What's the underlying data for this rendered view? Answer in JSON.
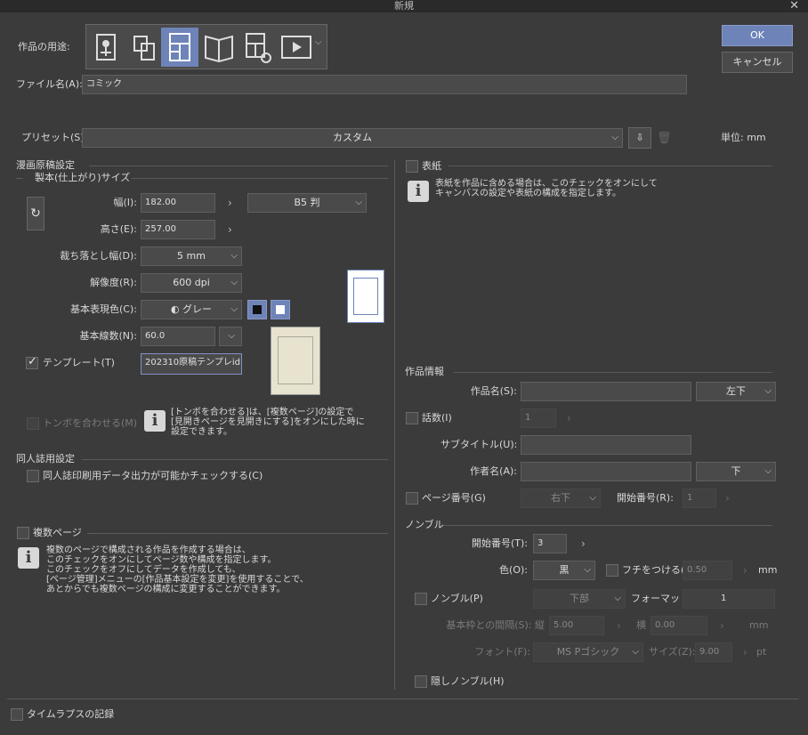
{
  "window": {
    "title": "新規"
  },
  "usage": {
    "label": "作品の用途:"
  },
  "buttons": {
    "ok": "OK",
    "cancel": "キャンセル"
  },
  "file": {
    "label": "ファイル名(A):",
    "value": "コミック"
  },
  "preset": {
    "label": "プリセット(S):",
    "value": "カスタム",
    "unit_label": "単位:",
    "unit_value": "mm"
  },
  "manga": {
    "section": "漫画原稿設定",
    "size_section": "製本(仕上がり)サイズ",
    "width_label": "幅(I):",
    "width_value": "182.00",
    "size_preset": "B5 判",
    "height_label": "高さ(E):",
    "height_value": "257.00",
    "bleed_label": "裁ち落とし幅(D):",
    "bleed_value": "5 mm",
    "resolution_label": "解像度(R):",
    "resolution_value": "600 dpi",
    "color_label": "基本表現色(C):",
    "color_value": "グレー",
    "lines_label": "基本線数(N):",
    "lines_value": "60.0",
    "template_label": "テンプレート(T)",
    "template_value": "202310原稿テンプレid",
    "tombo_label": "トンボを合わせる(M)",
    "tombo_note": [
      "[トンボを合わせる]は、[複数ページ]の設定で",
      "[見開きページを見開きにする]をオンにした時に",
      "設定できます。"
    ]
  },
  "doujin": {
    "section": "同人誌用設定",
    "check_label": "同人誌印刷用データ出力が可能かチェックする(C)"
  },
  "multipage": {
    "label": "複数ページ",
    "note": [
      "複数のページで構成される作品を作成する場合は、",
      "このチェックをオンにしてページ数や構成を指定します。",
      "このチェックをオフにしてデータを作成しても、",
      "[ページ管理]メニューの[作品基本設定を変更]を使用することで、",
      "あとからでも複数ページの構成に変更することができます。"
    ]
  },
  "cover": {
    "label": "表紙",
    "note": [
      "表紙を作品に含める場合は、このチェックをオンにして",
      "キャンバスの設定や表紙の構成を指定します。"
    ]
  },
  "work_info": {
    "section": "作品情報",
    "title_label": "作品名(S):",
    "title_pos": "左下",
    "episode_label": "話数(I)",
    "episode_value": "1",
    "subtitle_label": "サブタイトル(U):",
    "author_label": "作者名(A):",
    "author_pos": "下",
    "page_number_label": "ページ番号(G)",
    "page_number_pos": "右下",
    "start_number_label": "開始番号(R):",
    "start_number_value": "1"
  },
  "nombre": {
    "section": "ノンブル",
    "start_label": "開始番号(T):",
    "start_value": "3",
    "color_label": "色(O):",
    "color_value": "黒",
    "border_label": "フチをつける(E)",
    "border_value": "0.50",
    "border_unit": "mm",
    "nombre_label": "ノンブル(P)",
    "nombre_pos": "下部",
    "format_label": "フォーマット",
    "format_value": "1",
    "gap_label": "基本枠との間隔(S):",
    "gap_v_label": "縦",
    "gap_v_value": "5.00",
    "gap_h_label": "横",
    "gap_h_value": "0.00",
    "gap_unit": "mm",
    "font_label": "フォント(F):",
    "font_value": "MS Pゴシック",
    "size_label": "サイズ(Z):",
    "size_value": "9.00",
    "size_unit": "pt",
    "hidden_label": "隠しノンブル(H)"
  },
  "timelapse": {
    "label": "タイムラプスの記録"
  }
}
